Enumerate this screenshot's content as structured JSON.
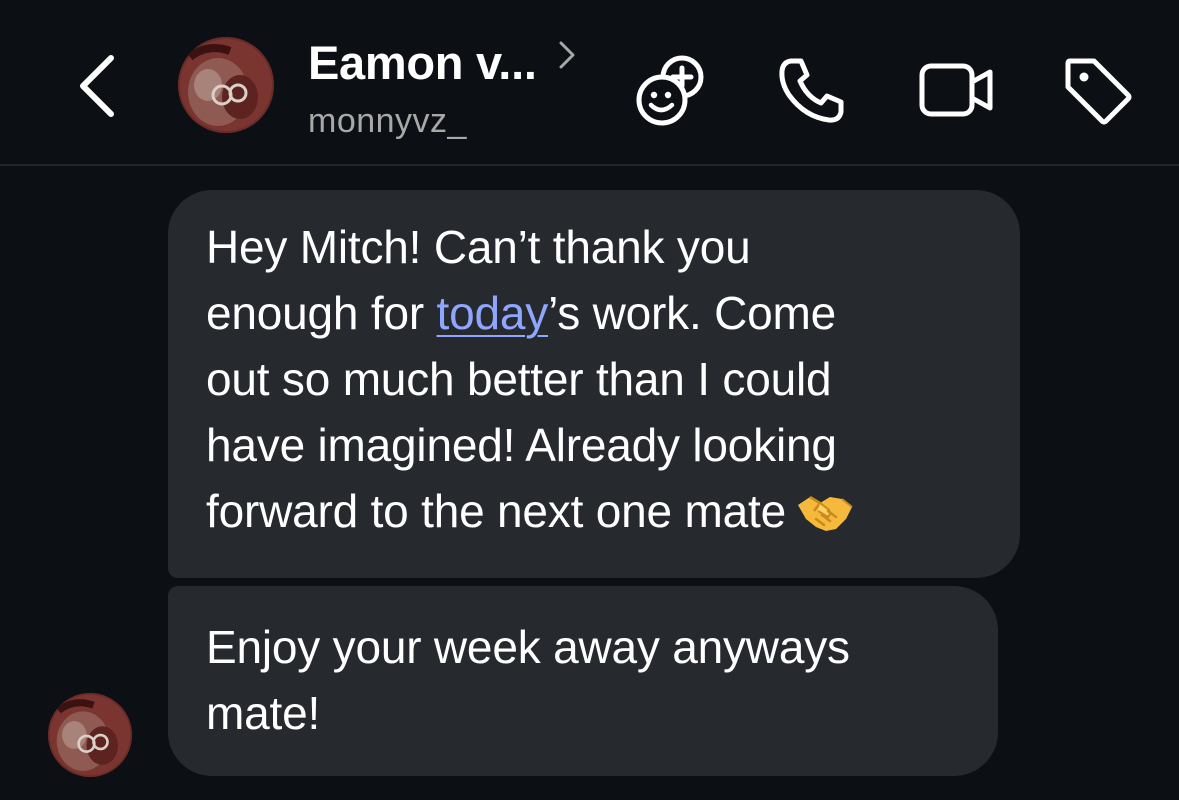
{
  "header": {
    "contact_name": "Eamon v...",
    "contact_handle": "monnyvz_",
    "icons": {
      "back": "chevron-left-icon",
      "name_arrow": "chevron-right-icon",
      "sticker": "sticker-add-icon",
      "call": "phone-icon",
      "video": "video-camera-icon",
      "tag": "tag-icon"
    }
  },
  "conversation": {
    "messages": [
      {
        "sender": "other",
        "lines": [
          "Hey Mitch! Can’t thank you",
          "enough for ",
          "today",
          "’s work. Come",
          "out so much better than I could",
          "have imagined! Already looking",
          "forward to the next one mate"
        ],
        "emoji": "handshake-emoji"
      },
      {
        "sender": "other",
        "lines": [
          "Enjoy your week away anyways",
          "mate!"
        ]
      }
    ]
  },
  "colors": {
    "background": "#0c1014",
    "bubble": "#26292e",
    "link": "#8fa6ff",
    "secondary_text": "#a8a8a8"
  }
}
